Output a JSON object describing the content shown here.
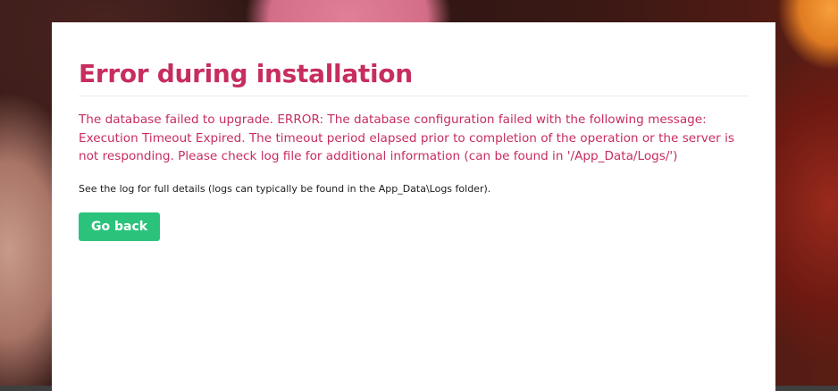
{
  "dialog": {
    "title": "Error during installation",
    "error_message": "The database failed to upgrade. ERROR: The database configuration failed with the following message: Execution Timeout Expired. The timeout period elapsed prior to completion of the operation or the server is not responding. Please check log file for additional information (can be found in '/App_Data/Logs/')",
    "log_note": "See the log for full details (logs can typically be found in the App_Data\\Logs folder).",
    "go_back_label": "Go back"
  },
  "colors": {
    "accent": "#c72d5e",
    "button": "#2bc37c",
    "panel": "#ffffff"
  }
}
